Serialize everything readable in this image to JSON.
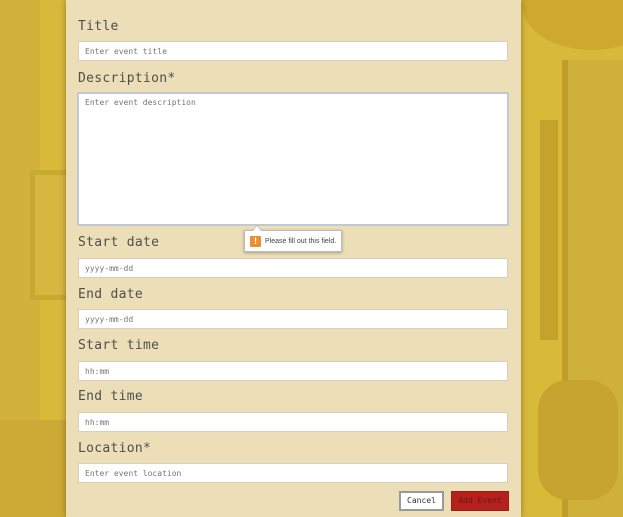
{
  "form": {
    "title": {
      "label": "Title",
      "placeholder": "Enter event title",
      "value": ""
    },
    "description": {
      "label": "Description*",
      "placeholder": "Enter event description",
      "value": ""
    },
    "start_date": {
      "label": "Start date",
      "placeholder": "yyyy-mm-dd",
      "value": ""
    },
    "end_date": {
      "label": "End date",
      "placeholder": "yyyy-mm-dd",
      "value": ""
    },
    "start_time": {
      "label": "Start time",
      "placeholder": "hh:mm",
      "value": ""
    },
    "end_time": {
      "label": "End time",
      "placeholder": "hh:mm",
      "value": ""
    },
    "location": {
      "label": "Location*",
      "placeholder": "Enter event location",
      "value": ""
    }
  },
  "validation": {
    "message": "Please fill out this field.",
    "icon": "warning-icon",
    "icon_glyph": "!"
  },
  "buttons": {
    "cancel": "Cancel",
    "add": "Add Event"
  },
  "colors": {
    "panel": "#ecdeb7",
    "background": "#d9b93a",
    "add_button": "#b5211c",
    "warning": "#e8912c"
  }
}
